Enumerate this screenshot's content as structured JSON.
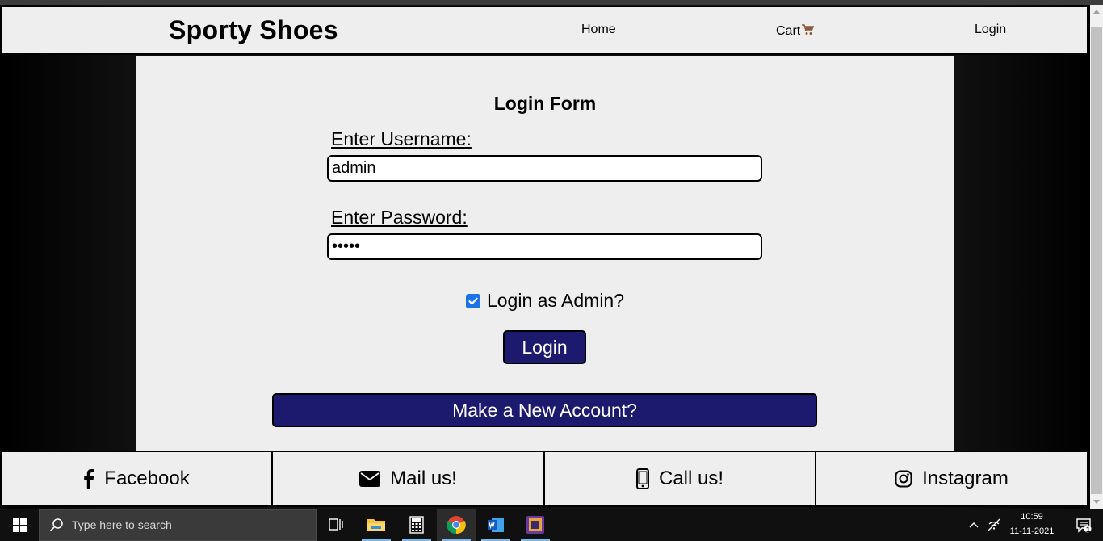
{
  "navbar": {
    "brand": "Sporty Shoes",
    "links": {
      "home": "Home",
      "cart": "Cart",
      "login": "Login"
    }
  },
  "form": {
    "title": "Login Form",
    "username_label": "Enter Username:",
    "username_value": "admin",
    "password_label": "Enter Password:",
    "password_value": "•••••",
    "admin_checkbox_label": "Login as Admin?",
    "admin_checked": true,
    "login_button": "Login",
    "new_account_button": "Make a New Account?"
  },
  "footer": {
    "items": [
      {
        "label": "Facebook",
        "icon": "facebook-icon"
      },
      {
        "label": "Mail us!",
        "icon": "envelope-icon"
      },
      {
        "label": "Call us!",
        "icon": "mobile-phone-icon"
      },
      {
        "label": "Instagram",
        "icon": "instagram-icon"
      }
    ]
  },
  "taskbar": {
    "search_placeholder": "Type here to search",
    "time": "10:59",
    "date": "11-11-2021",
    "notification_count": "1"
  },
  "colors": {
    "button_bg": "#1c1a6e",
    "panel_bg": "#eeeeee",
    "page_bg": "#000000"
  }
}
